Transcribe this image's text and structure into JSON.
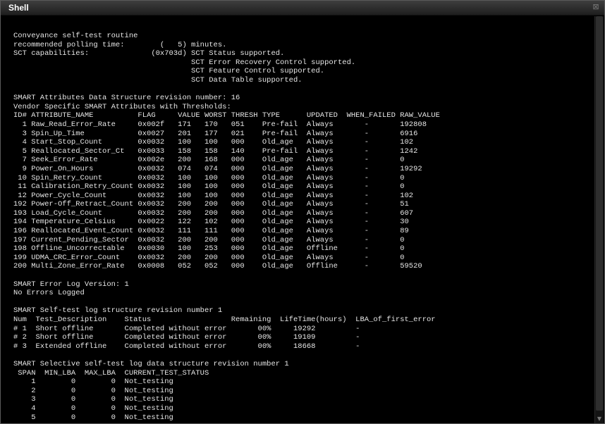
{
  "window": {
    "title": "Shell",
    "close_icon": "⊠"
  },
  "terminal": {
    "lines": [
      "Conveyance self-test routine",
      "recommended polling time:        (   5) minutes.",
      "SCT capabilities:              (0x703d) SCT Status supported.",
      "                                        SCT Error Recovery Control supported.",
      "                                        SCT Feature Control supported.",
      "                                        SCT Data Table supported.",
      "",
      "SMART Attributes Data Structure revision number: 16",
      "Vendor Specific SMART Attributes with Thresholds:",
      "ID# ATTRIBUTE_NAME          FLAG     VALUE WORST THRESH TYPE      UPDATED  WHEN_FAILED RAW_VALUE",
      "  1 Raw_Read_Error_Rate     0x002f   171   170   051    Pre-fail  Always       -       192808",
      "  3 Spin_Up_Time            0x0027   201   177   021    Pre-fail  Always       -       6916",
      "  4 Start_Stop_Count        0x0032   100   100   000    Old_age   Always       -       102",
      "  5 Reallocated_Sector_Ct   0x0033   158   158   140    Pre-fail  Always       -       1242",
      "  7 Seek_Error_Rate         0x002e   200   168   000    Old_age   Always       -       0",
      "  9 Power_On_Hours          0x0032   074   074   000    Old_age   Always       -       19292",
      " 10 Spin_Retry_Count        0x0032   100   100   000    Old_age   Always       -       0",
      " 11 Calibration_Retry_Count 0x0032   100   100   000    Old_age   Always       -       0",
      " 12 Power_Cycle_Count       0x0032   100   100   000    Old_age   Always       -       102",
      "192 Power-Off_Retract_Count 0x0032   200   200   000    Old_age   Always       -       51",
      "193 Load_Cycle_Count        0x0032   200   200   000    Old_age   Always       -       607",
      "194 Temperature_Celsius     0x0022   122   102   000    Old_age   Always       -       30",
      "196 Reallocated_Event_Count 0x0032   111   111   000    Old_age   Always       -       89",
      "197 Current_Pending_Sector  0x0032   200   200   000    Old_age   Always       -       0",
      "198 Offline_Uncorrectable   0x0030   100   253   000    Old_age   Offline      -       0",
      "199 UDMA_CRC_Error_Count    0x0032   200   200   000    Old_age   Always       -       0",
      "200 Multi_Zone_Error_Rate   0x0008   052   052   000    Old_age   Offline      -       59520",
      "",
      "SMART Error Log Version: 1",
      "No Errors Logged",
      "",
      "SMART Self-test log structure revision number 1",
      "Num  Test_Description    Status                  Remaining  LifeTime(hours)  LBA_of_first_error",
      "# 1  Short offline       Completed without error       00%     19292         -",
      "# 2  Short offline       Completed without error       00%     19109         -",
      "# 3  Extended offline    Completed without error       00%     18668         -",
      "",
      "SMART Selective self-test log data structure revision number 1",
      " SPAN  MIN_LBA  MAX_LBA  CURRENT_TEST_STATUS",
      "    1        0        0  Not_testing",
      "    2        0        0  Not_testing",
      "    3        0        0  Not_testing",
      "    4        0        0  Not_testing",
      "    5        0        0  Not_testing"
    ]
  },
  "scrollbar": {
    "down_arrow": "▼"
  }
}
